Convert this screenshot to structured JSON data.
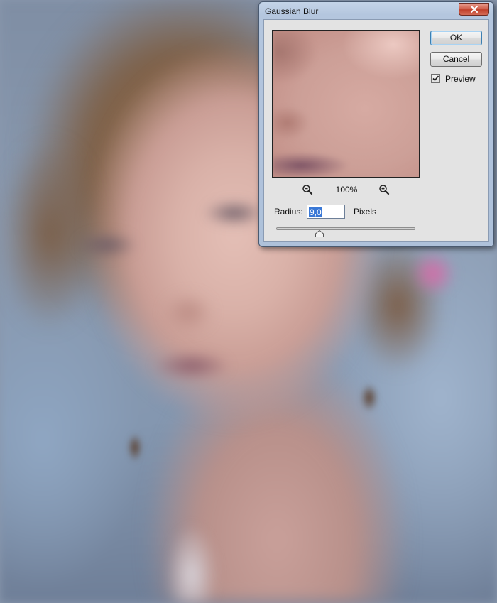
{
  "dialog": {
    "title": "Gaussian Blur",
    "zoom_level": "100%",
    "radius_label": "Radius:",
    "radius_value": "9,0",
    "radius_unit": "Pixels",
    "ok_label": "OK",
    "cancel_label": "Cancel",
    "preview_label": "Preview",
    "preview_checked": true
  },
  "icons": {
    "close": "close-icon",
    "zoom_out": "zoom-out-icon",
    "zoom_in": "zoom-in-icon",
    "check": "checkmark-icon",
    "slider_thumb": "slider-thumb-icon"
  },
  "colors": {
    "close_button": "#c1402b",
    "selection": "#3a78d6",
    "frame": "#b4c6de"
  }
}
